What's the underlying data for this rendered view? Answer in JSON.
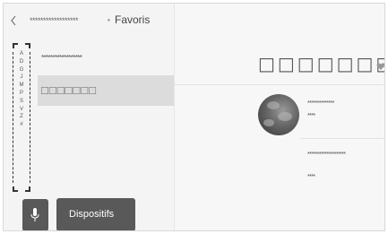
{
  "header": {
    "back_icon": "chevron-left-icon",
    "parent_label": "******************",
    "separator": "•",
    "current_label": "Favoris"
  },
  "alpha_index": [
    "A",
    "D",
    "G",
    "J",
    "M",
    "P",
    "S",
    "V",
    "Z",
    "#"
  ],
  "list": {
    "items": [
      {
        "label": "******************"
      },
      {
        "label": "□□□□□□□"
      }
    ]
  },
  "bottom": {
    "mic_icon": "microphone-icon",
    "devices_label": "Dispositifs"
  },
  "detail": {
    "title": "□□□□□□□",
    "favorite_icon": "heart-icon",
    "album_art_icon": "album-art",
    "line1": "**************",
    "line2": "****",
    "line3": "********************",
    "line4": "****"
  }
}
